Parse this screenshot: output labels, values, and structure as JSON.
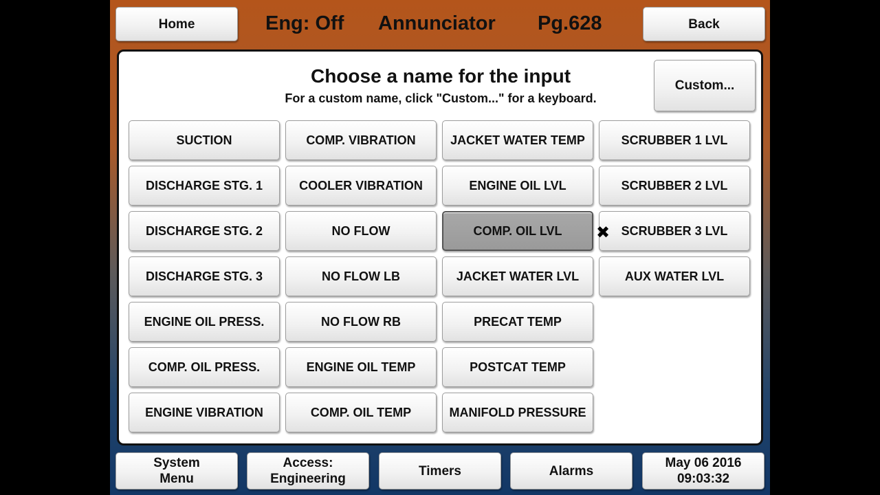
{
  "header": {
    "home_label": "Home",
    "engine_status": "Eng: Off",
    "screen_title": "Annunciator",
    "page_number": "Pg.628",
    "back_label": "Back"
  },
  "panel": {
    "title": "Choose a name for the input",
    "subtitle": "For a custom name, click \"Custom...\" for a keyboard.",
    "custom_label": "Custom..."
  },
  "columns": [
    [
      "SUCTION",
      "DISCHARGE STG. 1",
      "DISCHARGE STG. 2",
      "DISCHARGE STG. 3",
      "ENGINE OIL PRESS.",
      "COMP. OIL PRESS.",
      "ENGINE VIBRATION"
    ],
    [
      "COMP. VIBRATION",
      "COOLER VIBRATION",
      "NO FLOW",
      "NO FLOW LB",
      "NO FLOW RB",
      "ENGINE OIL TEMP",
      "COMP. OIL TEMP"
    ],
    [
      "JACKET WATER TEMP",
      "ENGINE OIL LVL",
      "COMP. OIL LVL",
      "JACKET WATER LVL",
      "PRECAT TEMP",
      "POSTCAT TEMP",
      "MANIFOLD PRESSURE"
    ],
    [
      "SCRUBBER 1 LVL",
      "SCRUBBER 2 LVL",
      "SCRUBBER 3 LVL",
      "AUX WATER LVL"
    ]
  ],
  "selected": "COMP. OIL LVL",
  "footer": {
    "system_menu": [
      "System",
      "Menu"
    ],
    "access": [
      "Access:",
      "Engineering"
    ],
    "timers": "Timers",
    "alarms": "Alarms",
    "date": "May 06 2016",
    "time": "09:03:32"
  },
  "cursor_icon": "close-x-cursor-icon",
  "colors": {
    "top_background": "#b4551b",
    "bottom_background": "#123766",
    "selected_button": "#9a9a9a"
  }
}
